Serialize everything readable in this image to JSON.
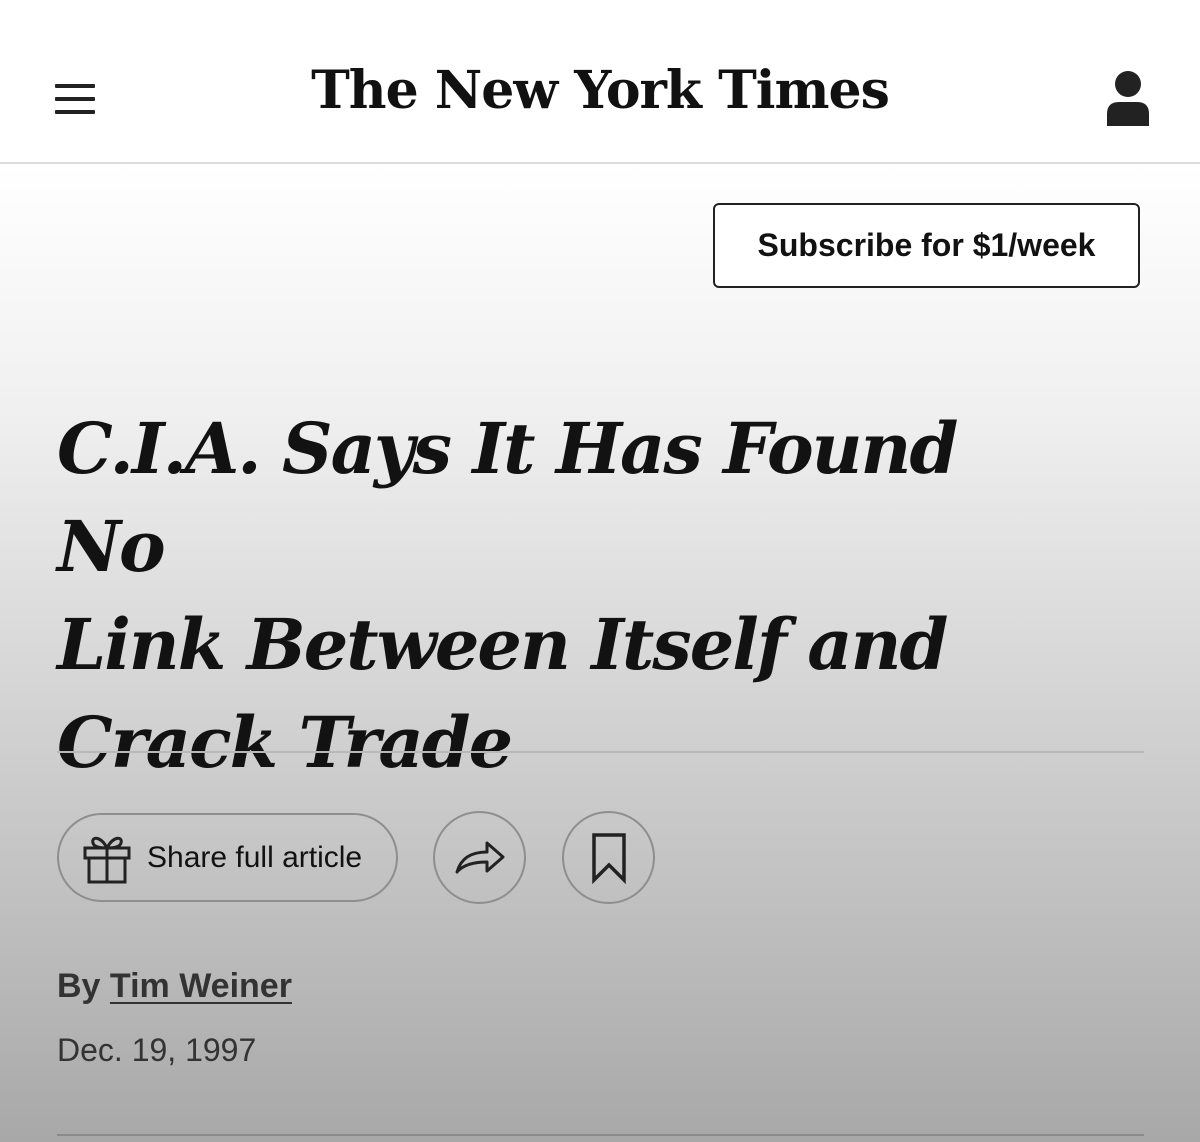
{
  "header": {
    "masthead": "The New York Times",
    "menu_icon": "hamburger-menu-icon",
    "account_icon": "user-account-icon"
  },
  "subscribe": {
    "label": "Subscribe for $1/week"
  },
  "article": {
    "headline_lines": [
      "C.I.A. Says It Has Found No",
      "Link Between Itself and",
      "Crack Trade"
    ],
    "byline_prefix": "By",
    "author": "Tim Weiner",
    "date": "Dec. 19, 1997"
  },
  "actions": {
    "share_label": "Share full article",
    "gift_icon": "gift-icon",
    "share_icon": "share-arrow-icon",
    "bookmark_icon": "bookmark-icon"
  },
  "colors": {
    "text": "#121212",
    "border": "#8e8e8e"
  }
}
